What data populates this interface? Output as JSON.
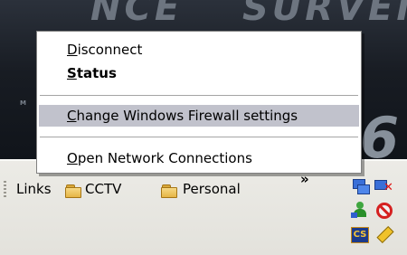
{
  "wallpaper": {
    "text_left": "NCE",
    "text_right": "SURVEIL",
    "text_big": "6",
    "text_tm": "M"
  },
  "context_menu": {
    "items": [
      {
        "id": "disconnect",
        "label": "Disconnect",
        "mnemonic": "D",
        "bold": false
      },
      {
        "id": "status",
        "label": "Status",
        "mnemonic": "S",
        "bold": true
      },
      {
        "id": "change_firewall",
        "label": "Change Windows Firewall settings",
        "mnemonic": "C",
        "highlighted": true
      },
      {
        "id": "open_connections",
        "label": "Open Network Connections",
        "mnemonic": "O"
      }
    ]
  },
  "links_toolbar": {
    "label": "Links",
    "items": [
      {
        "label": "CCTV",
        "icon": "folder-icon"
      },
      {
        "label": "Personal",
        "icon": "folder-icon"
      }
    ],
    "overflow_chevron": "»"
  },
  "system_tray": {
    "icons": [
      "network-connection-icon",
      "network-disabled-icon",
      "user-network-icon",
      "blocked-icon",
      "cs-badge-icon",
      "pencil-icon"
    ],
    "cs_badge_text": "CS"
  },
  "colors": {
    "menu_highlight": "#c1c2cc",
    "taskbar": "#ecebe6",
    "wallpaper_dark": "#181c23"
  }
}
